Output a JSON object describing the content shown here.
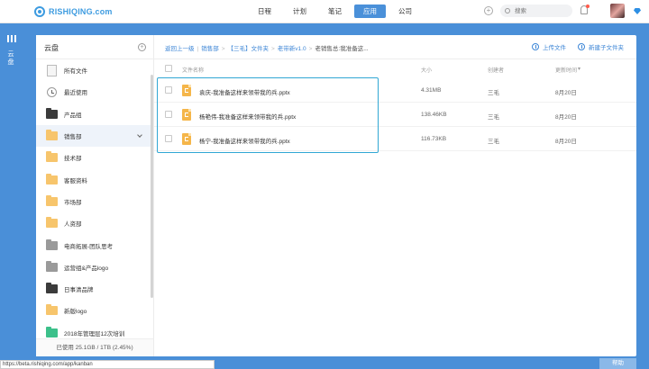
{
  "app": {
    "logo_text": "RISHIQING.com"
  },
  "nav": {
    "items": [
      {
        "label": "日程"
      },
      {
        "label": "计划"
      },
      {
        "label": "笔记"
      },
      {
        "label": "应用",
        "active": true
      },
      {
        "label": "公司"
      }
    ]
  },
  "search": {
    "placeholder": "搜索"
  },
  "leftbar": {
    "label": "云盘"
  },
  "sidebar": {
    "title": "云盘",
    "items": [
      {
        "label": "所有文件",
        "icon": "doc"
      },
      {
        "label": "最近使用",
        "icon": "clock"
      },
      {
        "label": "产品组",
        "icon": "folder-dark"
      },
      {
        "label": "销售部",
        "icon": "folder-yellow",
        "active": true
      },
      {
        "label": "技术部",
        "icon": "folder-yellow"
      },
      {
        "label": "客服资料",
        "icon": "folder-yellow"
      },
      {
        "label": "市场部",
        "icon": "folder-yellow"
      },
      {
        "label": "人资部",
        "icon": "folder-yellow"
      },
      {
        "label": "电商拓展-团队思考",
        "icon": "folder-gray"
      },
      {
        "label": "运营组&产品logo",
        "icon": "folder-gray"
      },
      {
        "label": "日事清品牌",
        "icon": "folder-dark"
      },
      {
        "label": "新版logo",
        "icon": "folder-yellow"
      },
      {
        "label": "2018年管理层12次培训",
        "icon": "folder-green"
      }
    ],
    "usage": "已使用 25.1GB / 1TB (2.45%)"
  },
  "breadcrumb": {
    "back": "返回上一级",
    "items": [
      "销售部",
      "【三毛】文件夹",
      "老带新v1.0",
      "老销售总:我准备这..."
    ]
  },
  "actions": {
    "upload": "上传文件",
    "new_folder": "新建子文件夹"
  },
  "table": {
    "headers": {
      "name": "文件名称",
      "size": "大小",
      "creator": "创建者",
      "updated": "更新时间"
    },
    "rows": [
      {
        "name": "袁庆-我准备这样来领带我的兵.pptx",
        "size": "4.31MB",
        "creator": "三毛",
        "updated": "8月20日"
      },
      {
        "name": "杨艳伟-我准备这样来领带我的兵.pptx",
        "size": "138.46KB",
        "creator": "三毛",
        "updated": "8月20日"
      },
      {
        "name": "杨宁-我准备这样来领带我的兵.pptx",
        "size": "116.73KB",
        "creator": "三毛",
        "updated": "8月20日"
      }
    ]
  },
  "status_url": "https://beta.rishiqing.com/app/kanban",
  "help_label": "帮助",
  "colors": {
    "accent": "#4a8fd8",
    "selection": "#31a7d4",
    "file": "#f5b64a"
  }
}
